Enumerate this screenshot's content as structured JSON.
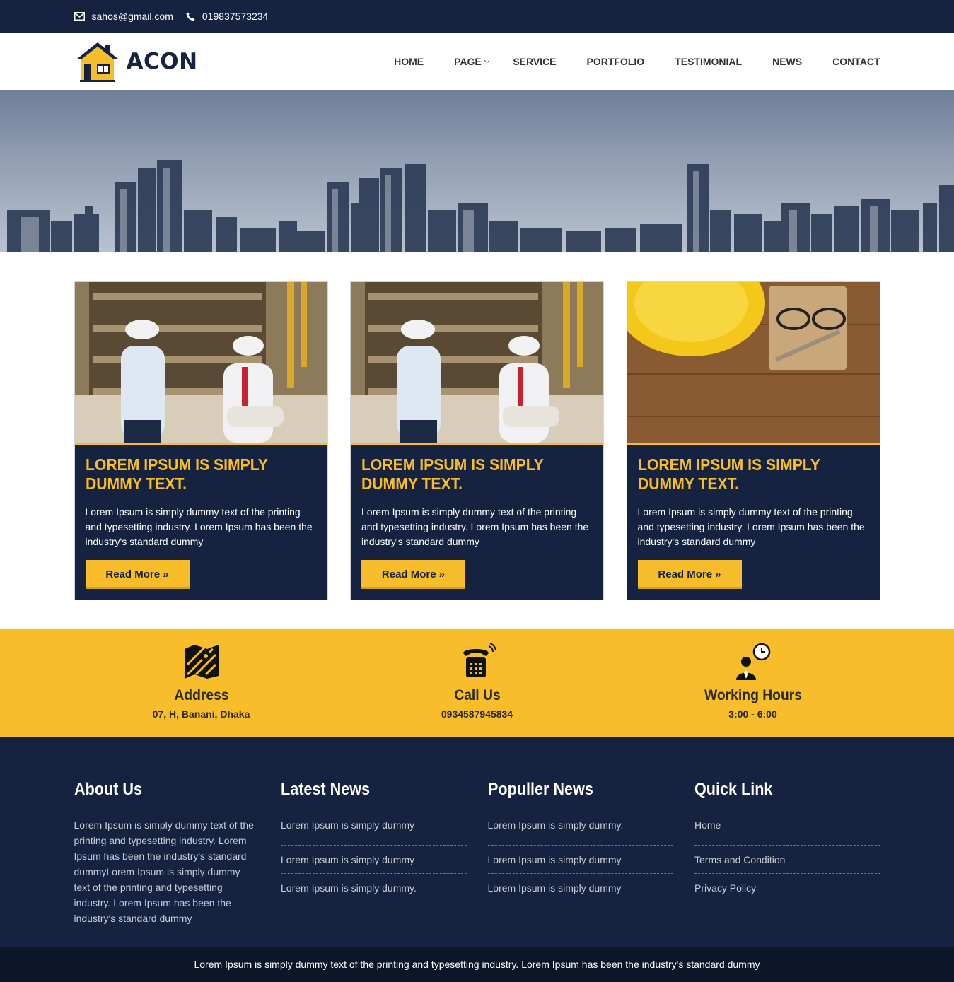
{
  "topbar": {
    "email": "sahos@gmail.com",
    "phone": "019837573234"
  },
  "brand": {
    "name": "ACON"
  },
  "nav": {
    "items": [
      "HOME",
      "PAGE",
      "SERVICE",
      "PORTFOLIO",
      "TESTIMONIAL",
      "NEWS",
      "CONTACT"
    ]
  },
  "cards": [
    {
      "title": "LOREM IPSUM IS SIMPLY DUMMY TEXT.",
      "text": "Lorem Ipsum is simply dummy text of the printing and typesetting industry. Lorem Ipsum has been the industry's standard dummy",
      "button": "Read More »"
    },
    {
      "title": "LOREM IPSUM IS SIMPLY DUMMY TEXT.",
      "text": "Lorem Ipsum is simply dummy text of the printing and typesetting industry. Lorem Ipsum has been the industry's standard dummy",
      "button": "Read More »"
    },
    {
      "title": "LOREM IPSUM IS SIMPLY DUMMY TEXT.",
      "text": "Lorem Ipsum is simply dummy text of the printing and typesetting industry. Lorem Ipsum has been the industry's standard dummy",
      "button": "Read More »"
    }
  ],
  "info": [
    {
      "title": "Address",
      "value": "07, H, Banani, Dhaka",
      "icon": "map-icon"
    },
    {
      "title": "Call Us",
      "value": "0934587945834",
      "icon": "telephone-icon"
    },
    {
      "title": "Working Hours",
      "value": "3:00 - 6:00",
      "icon": "person-clock-icon"
    }
  ],
  "footer": {
    "about": {
      "title": "About Us",
      "text": "Lorem Ipsum is simply dummy text of the printing and typesetting industry. Lorem Ipsum has been the industry's standard dummyLorem Ipsum is simply dummy text of the printing and typesetting industry. Lorem Ipsum has been the industry's standard dummy"
    },
    "latest": {
      "title": "Latest News",
      "items": [
        "Lorem Ipsum is simply dummy",
        "Lorem Ipsum is simply dummy",
        "Lorem Ipsum is simply dummy."
      ]
    },
    "popular": {
      "title": "Populler News",
      "items": [
        "Lorem Ipsum is simply dummy.",
        "Lorem Ipsum is simply dummy",
        "Lorem Ipsum is simply dummy"
      ]
    },
    "quick": {
      "title": "Quick Link",
      "items": [
        "Home",
        "Terms and Condition",
        "Privacy Policy"
      ]
    }
  },
  "copyright": "Lorem Ipsum is simply dummy text of the printing and typesetting industry. Lorem Ipsum has been the industry's standard dummy",
  "colors": {
    "navy": "#152340",
    "accent": "#f7bd2a"
  }
}
